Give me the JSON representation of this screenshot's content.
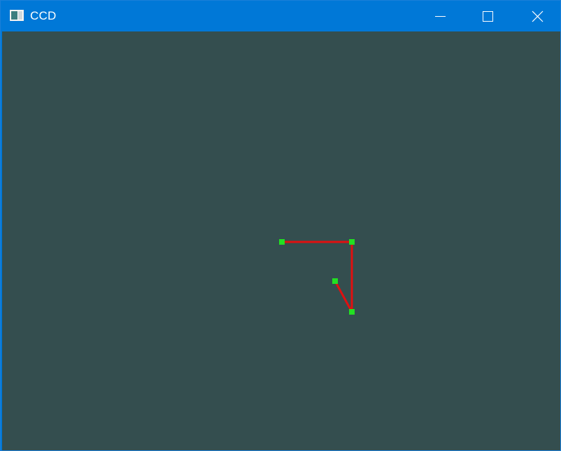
{
  "window": {
    "title": "CCD",
    "accent_color": "#0078d7",
    "background_color": "#344e4f",
    "icons": {
      "app": "app-window-icon",
      "minimize": "minimize-icon",
      "maximize": "maximize-icon",
      "close": "close-icon"
    }
  },
  "scene": {
    "description_colors": {
      "segment": "#e01010",
      "joint": "#22e022"
    },
    "joints": [
      {
        "id": "base"
      },
      {
        "id": "joint-1"
      },
      {
        "id": "joint-2"
      },
      {
        "id": "end-effector"
      }
    ]
  }
}
